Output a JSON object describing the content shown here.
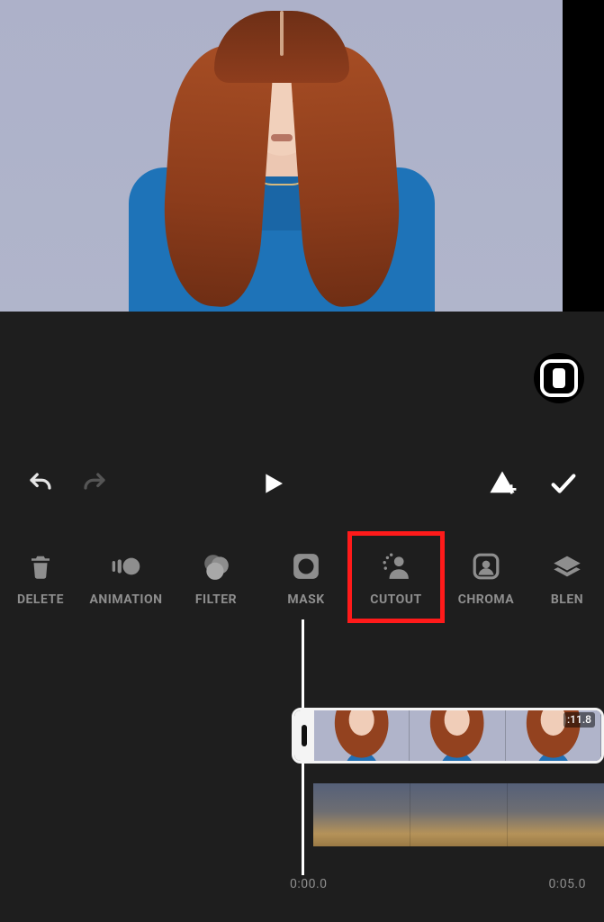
{
  "toolbar": {
    "items": [
      {
        "label": "DELETE"
      },
      {
        "label": "ANIMATION"
      },
      {
        "label": "FILTER"
      },
      {
        "label": "MASK"
      },
      {
        "label": "CUTOUT"
      },
      {
        "label": "CHROMA"
      },
      {
        "label": "BLEN"
      }
    ],
    "highlighted_index": 4
  },
  "clip": {
    "duration_badge": ":11.8"
  },
  "timeline": {
    "start": "0:00.0",
    "end": "0:05.0"
  }
}
